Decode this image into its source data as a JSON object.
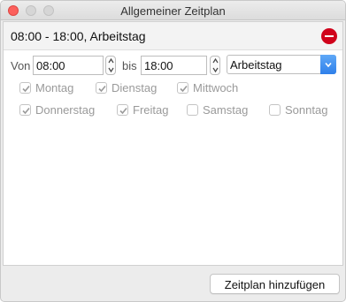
{
  "window": {
    "title": "Allgemeiner Zeitplan"
  },
  "schedule": {
    "header": "08:00 - 18:00, Arbeitstag",
    "from_label": "Von",
    "to_label": "bis",
    "from_value": "08:00",
    "to_value": "18:00",
    "type_selected": "Arbeitstag"
  },
  "days": [
    {
      "label": "Montag",
      "checked": true
    },
    {
      "label": "Dienstag",
      "checked": true
    },
    {
      "label": "Mittwoch",
      "checked": true
    },
    {
      "label": "Donnerstag",
      "checked": true
    },
    {
      "label": "Freitag",
      "checked": true
    },
    {
      "label": "Samstag",
      "checked": false
    },
    {
      "label": "Sonntag",
      "checked": false
    }
  ],
  "footer": {
    "add_button": "Zeitplan hinzufügen"
  },
  "colors": {
    "close": "#fc605c",
    "remove": "#d0021b",
    "select_accent": "#2f80ea"
  },
  "icons": {
    "remove": "minus-circle-icon",
    "check": "checkmark-icon",
    "stepper": "stepper-arrows-icon",
    "dropdown": "chevron-updown-icon"
  }
}
